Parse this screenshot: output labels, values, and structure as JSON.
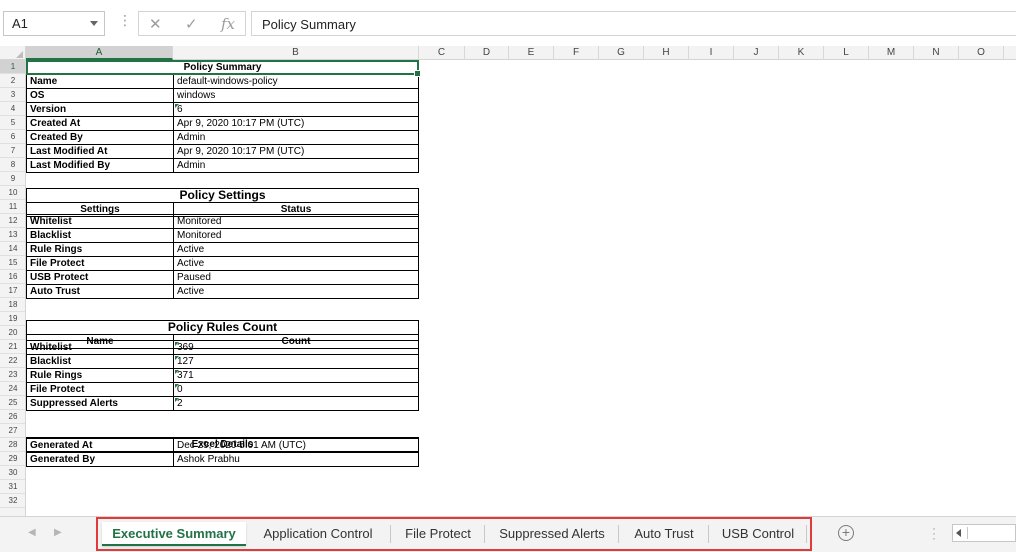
{
  "formula_bar": {
    "name_box": "A1",
    "cancel_glyph": "✕",
    "enter_glyph": "✓",
    "fx_glyph": "fx",
    "formula": "Policy Summary"
  },
  "columns": [
    "A",
    "B",
    "C",
    "D",
    "E",
    "F",
    "G",
    "H",
    "I",
    "J",
    "K",
    "L",
    "M",
    "N",
    "O"
  ],
  "rows": [
    "1",
    "2",
    "3",
    "4",
    "5",
    "6",
    "7",
    "8",
    "9",
    "10",
    "11",
    "12",
    "13",
    "14",
    "15",
    "16",
    "17",
    "18",
    "19",
    "20",
    "21",
    "22",
    "23",
    "24",
    "25",
    "26",
    "27",
    "28",
    "29",
    "30",
    "31",
    "32"
  ],
  "summary": {
    "title": "Policy Summary",
    "rows": [
      {
        "label": "Name",
        "value": "default-windows-policy"
      },
      {
        "label": "OS",
        "value": "windows"
      },
      {
        "label": "Version",
        "value": "6"
      },
      {
        "label": "Created At",
        "value": "Apr 9, 2020 10:17 PM (UTC)"
      },
      {
        "label": "Created By",
        "value": "Admin"
      },
      {
        "label": "Last Modified At",
        "value": "Apr 9, 2020 10:17 PM (UTC)"
      },
      {
        "label": "Last Modified By",
        "value": "Admin"
      }
    ]
  },
  "settings": {
    "title": "Policy Settings",
    "col1": "Settings",
    "col2": "Status",
    "rows": [
      {
        "label": "Whitelist",
        "value": "Monitored"
      },
      {
        "label": "Blacklist",
        "value": "Monitored"
      },
      {
        "label": "Rule Rings",
        "value": "Active"
      },
      {
        "label": "File Protect",
        "value": "Active"
      },
      {
        "label": "USB Protect",
        "value": "Paused"
      },
      {
        "label": "Auto Trust",
        "value": "Active"
      }
    ]
  },
  "rules": {
    "title": "Policy Rules Count",
    "col1": "Name",
    "col2": "Count",
    "rows": [
      {
        "label": "Whitelist",
        "value": "369"
      },
      {
        "label": "Blacklist",
        "value": "127"
      },
      {
        "label": "Rule Rings",
        "value": "371"
      },
      {
        "label": "File Protect",
        "value": "0"
      },
      {
        "label": "Suppressed Alerts",
        "value": "2"
      }
    ]
  },
  "excel": {
    "title": "Excel Details",
    "rows": [
      {
        "label": "Generated At",
        "value": "Dec 29, 2020 5:01 AM (UTC)"
      },
      {
        "label": "Generated By",
        "value": "Ashok Prabhu"
      }
    ]
  },
  "sheet_tabs": [
    "Executive Summary",
    "Application Control",
    "File Protect",
    "Suppressed Alerts",
    "Auto Trust",
    "USB Control"
  ],
  "add_sheet_glyph": "+",
  "colors": {
    "excel_green": "#217346",
    "highlight_red": "#e03a3a"
  }
}
